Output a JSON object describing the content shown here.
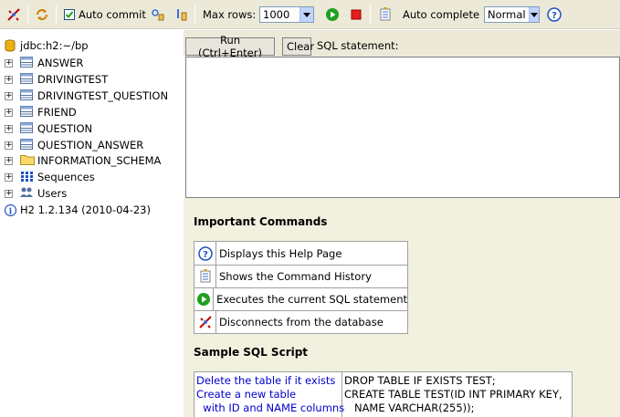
{
  "toolbar": {
    "auto_commit_label": "Auto commit",
    "auto_commit_checked": true,
    "max_rows_label": "Max rows:",
    "max_rows_value": "1000",
    "auto_complete_label": "Auto complete",
    "auto_complete_value": "Normal"
  },
  "tree": {
    "connection": "jdbc:h2:~/bp",
    "tables": [
      "ANSWER",
      "DRIVINGTEST",
      "DRIVINGTEST_QUESTION",
      "FRIEND",
      "QUESTION",
      "QUESTION_ANSWER"
    ],
    "schema": "INFORMATION_SCHEMA",
    "sequences": "Sequences",
    "users": "Users",
    "version": "H2 1.2.134 (2010-04-23)"
  },
  "editor": {
    "run_label": "Run (Ctrl+Enter)",
    "clear_label": "Clear",
    "statement_label": "SQL statement:"
  },
  "help": {
    "important_title": "Important Commands",
    "commands": [
      {
        "icon": "help-icon",
        "text": "Displays this Help Page"
      },
      {
        "icon": "history-icon",
        "text": "Shows the Command History"
      },
      {
        "icon": "run-icon",
        "text": "Executes the current SQL statement"
      },
      {
        "icon": "disconnect-icon",
        "text": "Disconnects from the database"
      }
    ],
    "sample_title": "Sample SQL Script",
    "script_comments": [
      "Delete the table if it exists",
      "Create a new table",
      "  with ID and NAME columns"
    ],
    "script_sql": [
      "DROP TABLE IF EXISTS TEST;",
      "CREATE TABLE TEST(ID INT PRIMARY KEY,",
      "   NAME VARCHAR(255));"
    ]
  },
  "colors": {
    "toolbar_bg": "#ece9d8",
    "help_bg": "#f2f1e0",
    "link_blue": "#0000cc"
  }
}
